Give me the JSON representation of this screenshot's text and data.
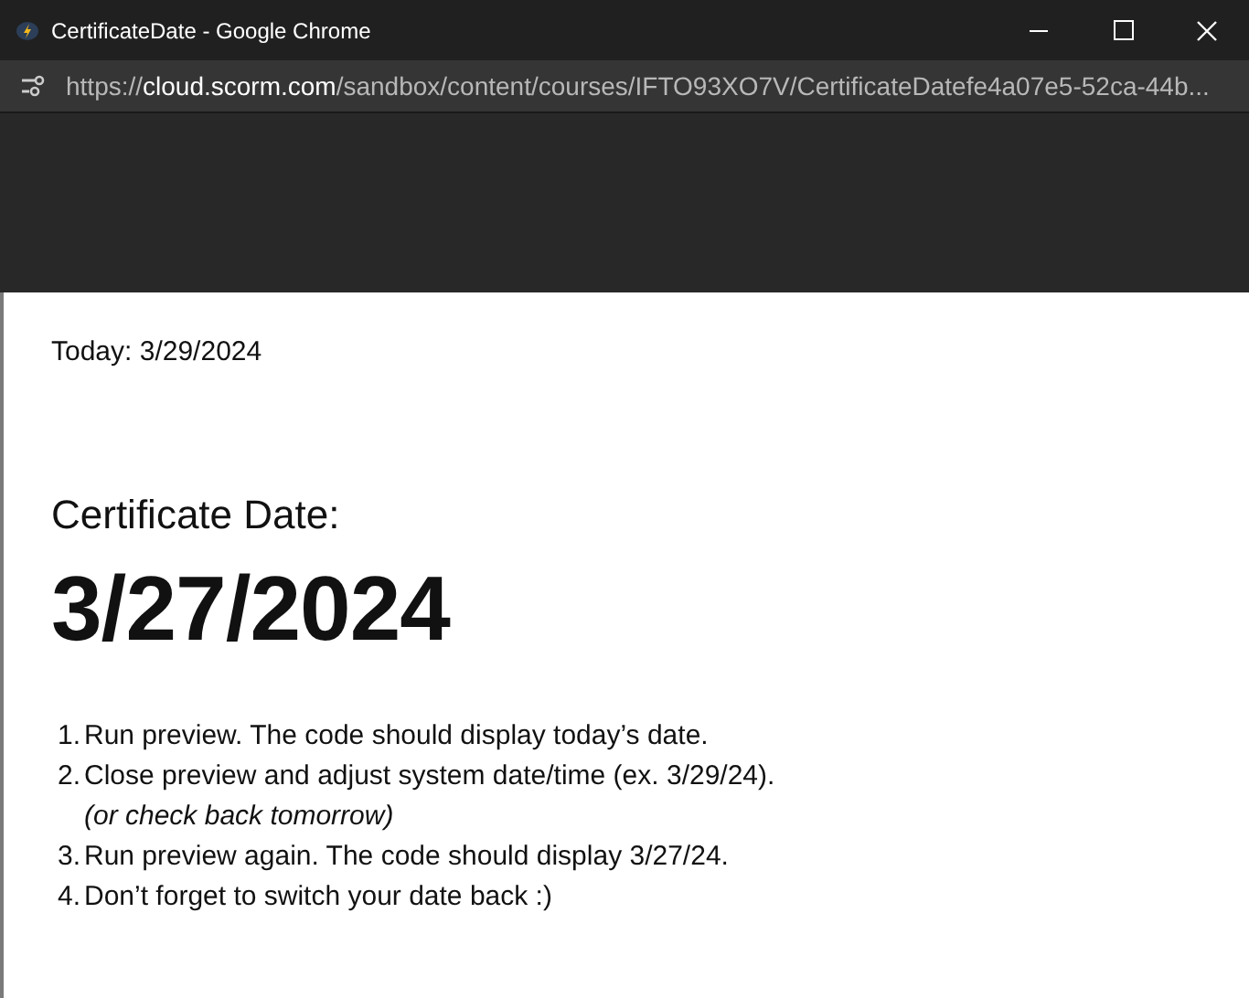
{
  "window": {
    "title": "CertificateDate - Google Chrome"
  },
  "address_bar": {
    "scheme": "https://",
    "host": "cloud.scorm.com",
    "path": "/sandbox/content/courses/IFTO93XO7V/CertificateDatefe4a07e5-52ca-44b..."
  },
  "content": {
    "today": "Today: 3/29/2024",
    "heading": "Certificate Date:",
    "date": "3/27/2024",
    "steps": [
      {
        "number": "1.",
        "text": "Run preview. The code should display today’s date."
      },
      {
        "number": "2.",
        "text": "Close preview and adjust system date/time (ex. 3/29/24).",
        "note": "(or check back tomorrow)"
      },
      {
        "number": "3.",
        "text": "Run preview again. The code should display 3/27/24."
      },
      {
        "number": "4.",
        "text": "Don’t forget to switch your date back :)"
      }
    ]
  }
}
